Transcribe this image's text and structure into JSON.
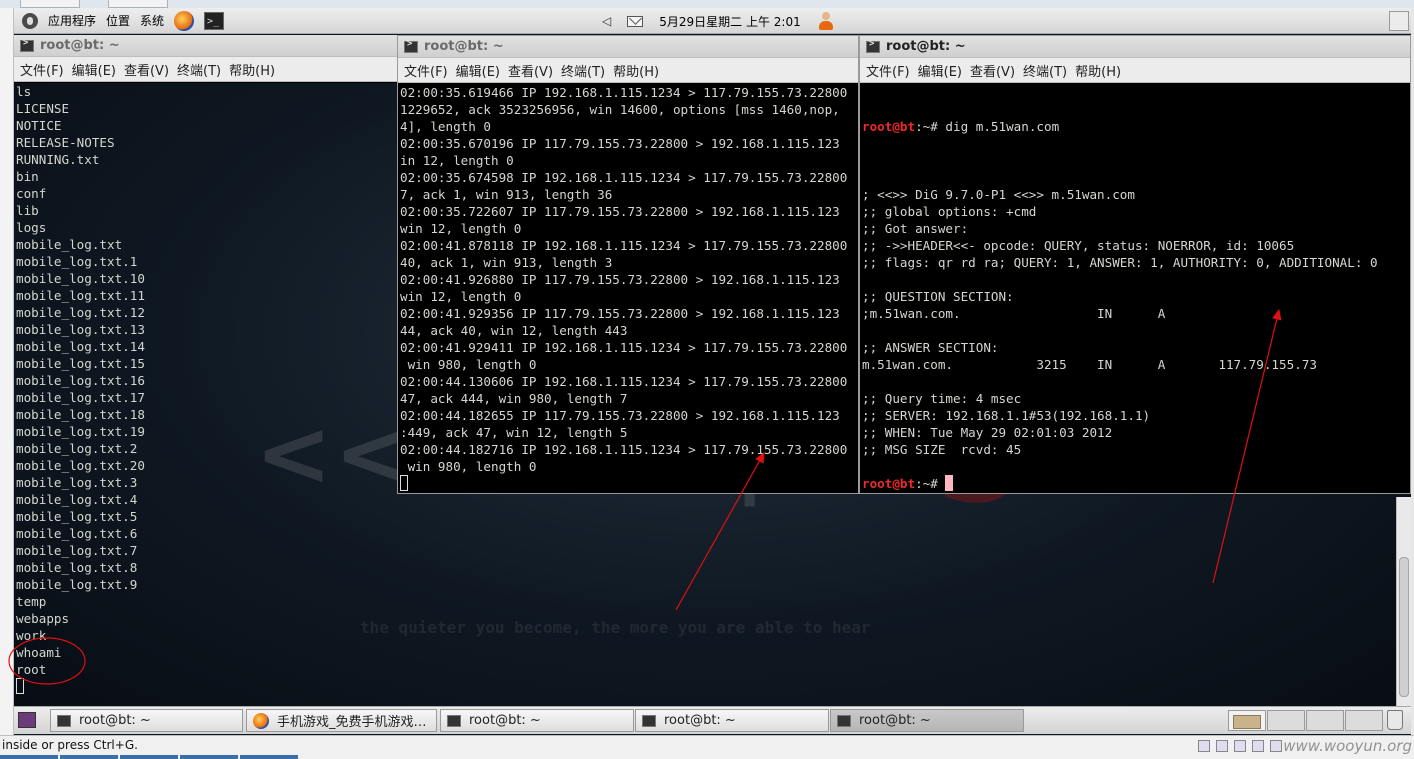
{
  "top_panel": {
    "menu": [
      "应用程序",
      "位置",
      "系统"
    ],
    "datetime": "5月29日星期二 上午  2:01"
  },
  "term_menu": [
    "文件(F)",
    "编辑(E)",
    "查看(V)",
    "终端(T)",
    "帮助(H)"
  ],
  "terminals": [
    {
      "title": "root@bt: ~",
      "lines": [
        "ls",
        "LICENSE",
        "NOTICE",
        "RELEASE-NOTES",
        "RUNNING.txt",
        "bin",
        "conf",
        "lib",
        "logs",
        "mobile_log.txt",
        "mobile_log.txt.1",
        "mobile_log.txt.10",
        "mobile_log.txt.11",
        "mobile_log.txt.12",
        "mobile_log.txt.13",
        "mobile_log.txt.14",
        "mobile_log.txt.15",
        "mobile_log.txt.16",
        "mobile_log.txt.17",
        "mobile_log.txt.18",
        "mobile_log.txt.19",
        "mobile_log.txt.2",
        "mobile_log.txt.20",
        "mobile_log.txt.3",
        "mobile_log.txt.4",
        "mobile_log.txt.5",
        "mobile_log.txt.6",
        "mobile_log.txt.7",
        "mobile_log.txt.8",
        "mobile_log.txt.9",
        "temp",
        "webapps",
        "work",
        "whoami",
        "root"
      ]
    },
    {
      "title": "root@bt: ~",
      "lines": [
        "02:00:35.619466 IP 192.168.1.115.1234 > 117.79.155.73.22800",
        "1229652, ack 3523256956, win 14600, options [mss 1460,nop,",
        "4], length 0",
        "02:00:35.670196 IP 117.79.155.73.22800 > 192.168.1.115.123",
        "in 12, length 0",
        "02:00:35.674598 IP 192.168.1.115.1234 > 117.79.155.73.22800",
        "7, ack 1, win 913, length 36",
        "02:00:35.722607 IP 117.79.155.73.22800 > 192.168.1.115.123",
        "win 12, length 0",
        "02:00:41.878118 IP 192.168.1.115.1234 > 117.79.155.73.22800",
        "40, ack 1, win 913, length 3",
        "02:00:41.926880 IP 117.79.155.73.22800 > 192.168.1.115.123",
        "win 12, length 0",
        "02:00:41.929356 IP 117.79.155.73.22800 > 192.168.1.115.123",
        "44, ack 40, win 12, length 443",
        "02:00:41.929411 IP 192.168.1.115.1234 > 117.79.155.73.22800",
        " win 980, length 0",
        "02:00:44.130606 IP 192.168.1.115.1234 > 117.79.155.73.22800",
        "47, ack 444, win 980, length 7",
        "02:00:44.182655 IP 117.79.155.73.22800 > 192.168.1.115.123",
        ":449, ack 47, win 12, length 5",
        "02:00:44.182716 IP 192.168.1.115.1234 > 117.79.155.73.22800",
        " win 980, length 0"
      ]
    },
    {
      "title": "root@bt: ~",
      "prompt": "root@bt",
      "prompt_suffix": ":~# ",
      "command": "dig m.51wan.com",
      "lines": [
        "",
        "; <<>> DiG 9.7.0-P1 <<>> m.51wan.com",
        ";; global options: +cmd",
        ";; Got answer:",
        ";; ->>HEADER<<- opcode: QUERY, status: NOERROR, id: 10065",
        ";; flags: qr rd ra; QUERY: 1, ANSWER: 1, AUTHORITY: 0, ADDITIONAL: 0",
        "",
        ";; QUESTION SECTION:",
        ";m.51wan.com.                  IN      A",
        "",
        ";; ANSWER SECTION:",
        "m.51wan.com.           3215    IN      A       117.79.155.73",
        "",
        ";; Query time: 4 msec",
        ";; SERVER: 192.168.1.1#53(192.168.1.1)",
        ";; WHEN: Tue May 29 02:01:03 2012",
        ";; MSG SIZE  rcvd: 45",
        ""
      ]
    }
  ],
  "wallpaper": {
    "logo_text": "<< back | track",
    "logo_number": "5",
    "quote": "the quieter you become, the more you are able to hear"
  },
  "taskbar": {
    "buttons": [
      {
        "label": "root@bt: ~",
        "icon": "terminal-icon",
        "active": false
      },
      {
        "label": "手机游戏_免费手机游戏…",
        "icon": "firefox-icon",
        "active": false
      },
      {
        "label": "root@bt: ~",
        "icon": "terminal-icon",
        "active": false
      },
      {
        "label": "root@bt: ~",
        "icon": "terminal-icon",
        "active": false
      },
      {
        "label": "root@bt: ~",
        "icon": "terminal-icon",
        "active": true
      }
    ]
  },
  "host_status": {
    "message": "inside or press Ctrl+G.",
    "watermark": "www.wooyun.org"
  },
  "colors": {
    "prompt": "#ef2929",
    "annotation": "#e01010",
    "terminal_bg": "#000000",
    "terminal_fg": "#d3d7cf"
  }
}
